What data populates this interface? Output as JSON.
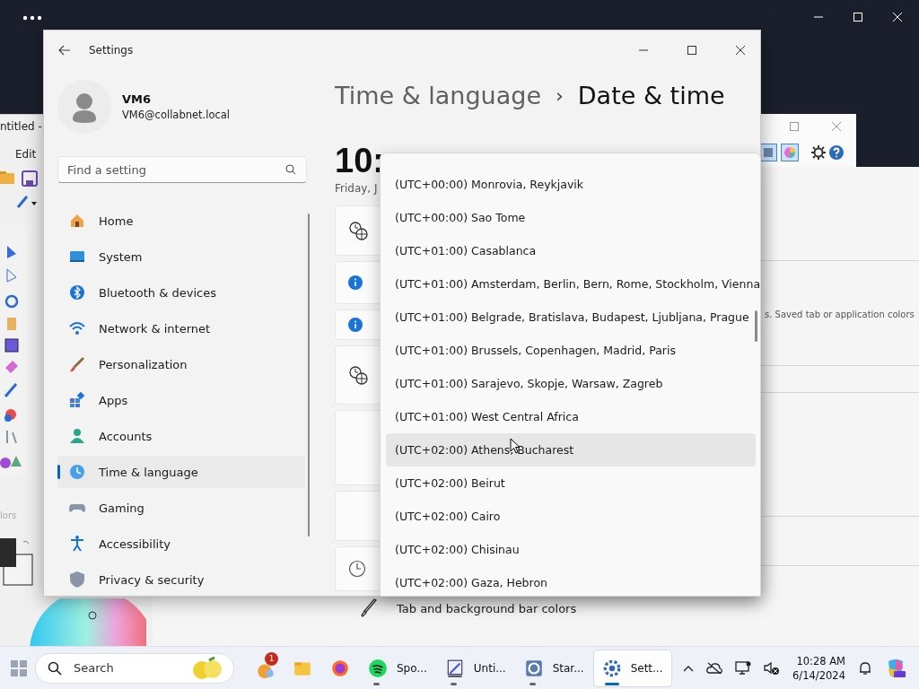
{
  "paint_window": {
    "title": "ntitled -",
    "menu_item": "Edit",
    "colors_label": "lors"
  },
  "background_content": {
    "description": "s.  Saved tab or application colors",
    "setting_label": "Tab and background bar colors"
  },
  "settings": {
    "title": "Settings",
    "user": {
      "name": "VM6",
      "email": "VM6@collabnet.local"
    },
    "search": {
      "placeholder": "Find a setting"
    },
    "nav": [
      {
        "label": "Home",
        "selected": false
      },
      {
        "label": "System",
        "selected": false
      },
      {
        "label": "Bluetooth & devices",
        "selected": false
      },
      {
        "label": "Network & internet",
        "selected": false
      },
      {
        "label": "Personalization",
        "selected": false
      },
      {
        "label": "Apps",
        "selected": false
      },
      {
        "label": "Accounts",
        "selected": false
      },
      {
        "label": "Time & language",
        "selected": true
      },
      {
        "label": "Gaming",
        "selected": false
      },
      {
        "label": "Accessibility",
        "selected": false
      },
      {
        "label": "Privacy & security",
        "selected": false
      }
    ],
    "breadcrumb": {
      "parent": "Time & language",
      "separator": "›",
      "current": "Date & time"
    },
    "clock": "10:",
    "date": "Friday, J"
  },
  "timezone_dropdown": {
    "items": [
      {
        "label": "(UTC+00:00) Monrovia, Reykjavik",
        "hovered": false
      },
      {
        "label": "(UTC+00:00) Sao Tome",
        "hovered": false
      },
      {
        "label": "(UTC+01:00) Casablanca",
        "hovered": false
      },
      {
        "label": "(UTC+01:00) Amsterdam, Berlin, Bern, Rome, Stockholm, Vienna",
        "hovered": false
      },
      {
        "label": "(UTC+01:00) Belgrade, Bratislava, Budapest, Ljubljana, Prague",
        "hovered": false
      },
      {
        "label": "(UTC+01:00) Brussels, Copenhagen, Madrid, Paris",
        "hovered": false
      },
      {
        "label": "(UTC+01:00) Sarajevo, Skopje, Warsaw, Zagreb",
        "hovered": false
      },
      {
        "label": "(UTC+01:00) West Central Africa",
        "hovered": false
      },
      {
        "label": "(UTC+02:00) Athens, Bucharest",
        "hovered": true
      },
      {
        "label": "(UTC+02:00) Beirut",
        "hovered": false
      },
      {
        "label": "(UTC+02:00) Cairo",
        "hovered": false
      },
      {
        "label": "(UTC+02:00) Chisinau",
        "hovered": false
      },
      {
        "label": "(UTC+02:00) Gaza, Hebron",
        "hovered": false
      }
    ]
  },
  "taskbar": {
    "search": {
      "placeholder": "Search"
    },
    "apps": [
      {
        "badge": "1",
        "running": false,
        "active": false
      },
      {
        "running": false,
        "active": false
      },
      {
        "running": false,
        "active": false
      },
      {
        "label": "Spo...",
        "running": true,
        "active": false
      },
      {
        "label": "Unti...",
        "running": true,
        "active": false
      },
      {
        "label": "Star...",
        "running": true,
        "active": false
      },
      {
        "label": "Sett...",
        "running": true,
        "active": true
      }
    ],
    "time": "10:28 AM",
    "date": "6/14/2024"
  }
}
